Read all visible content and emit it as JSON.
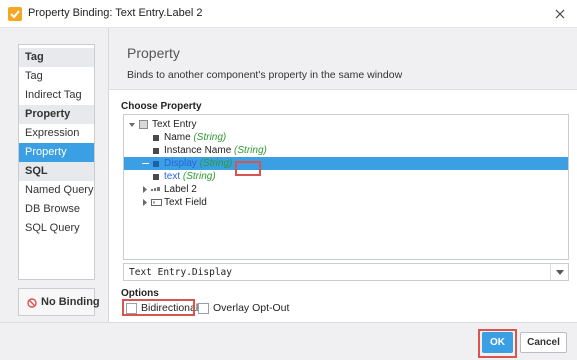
{
  "window": {
    "title": "Property Binding: Text Entry.Label 2",
    "close_icon": "close-icon",
    "app_icon": "checkmark-icon"
  },
  "sidebar": {
    "categories": [
      {
        "label": "Tag",
        "items": [
          {
            "label": "Tag",
            "selected": false
          },
          {
            "label": "Indirect Tag",
            "selected": false
          }
        ]
      },
      {
        "label": "Property",
        "items": [
          {
            "label": "Expression",
            "selected": false
          },
          {
            "label": "Property",
            "selected": true
          }
        ]
      },
      {
        "label": "SQL",
        "items": [
          {
            "label": "Named Query",
            "selected": false
          },
          {
            "label": "DB Browse",
            "selected": false
          },
          {
            "label": "SQL Query",
            "selected": false
          }
        ]
      }
    ],
    "no_binding_label": "No Binding",
    "no_binding_icon": "no-symbol-icon"
  },
  "header": {
    "title": "Property",
    "description": "Binds to another component's property in the same window"
  },
  "choose_property": {
    "label": "Choose Property",
    "tree": [
      {
        "label": "Text Entry",
        "type": "",
        "icon": "component-icon",
        "expanded": true
      },
      {
        "label": "Name",
        "type": "(String)",
        "icon": "property-icon"
      },
      {
        "label": "Instance Name",
        "type": "(String)",
        "icon": "property-icon"
      },
      {
        "label": "Display",
        "type": "(String)",
        "icon": "property-icon",
        "selected": true
      },
      {
        "label": "text",
        "type": "(String)",
        "icon": "property-icon"
      },
      {
        "label": "Label 2",
        "type": "",
        "icon": "label-icon",
        "expanded": false
      },
      {
        "label": "Text Field",
        "type": "",
        "icon": "textfield-icon",
        "expanded": false
      }
    ]
  },
  "property_path": {
    "value": "Text Entry.Display",
    "dropdown_icon": "chevron-down-icon"
  },
  "options": {
    "label": "Options",
    "bidirectional": {
      "label": "Bidirectional",
      "checked": false
    },
    "overlay_opt_out": {
      "label": "Overlay Opt-Out",
      "checked": false
    }
  },
  "footer": {
    "ok_label": "OK",
    "cancel_label": "Cancel"
  },
  "colors": {
    "accent": "#3b9fe3",
    "highlight": "#d9534f",
    "type_green": "#2e9a2e",
    "no_binding_red": "#d9534f"
  }
}
